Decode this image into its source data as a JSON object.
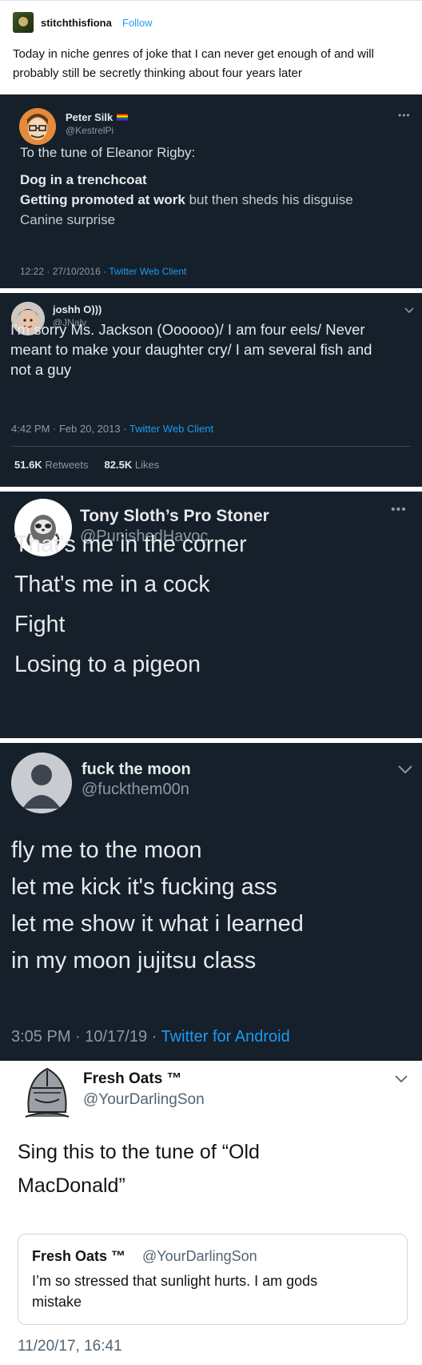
{
  "post": {
    "username": "stitchthisfiona",
    "follow_label": "Follow",
    "text": "Today in niche genres of joke that I can never get enough of and will probably still be secretly thinking about four years later"
  },
  "tweets": [
    {
      "display_name": "Peter Silk",
      "handle": "@KestrelPi",
      "icon_right": "more-icon",
      "lines": [
        {
          "text": "To the tune of Eleanor Rigby:",
          "style": "normal"
        },
        {
          "text": "Dog in a trenchcoat",
          "style": "bold"
        },
        {
          "text": "Getting promoted at work",
          "style": "bold"
        },
        {
          "text": " but then sheds his disguise",
          "style": "normal"
        },
        {
          "text": "Canine surprise",
          "style": "normal"
        }
      ],
      "timestamp": "12:22 · 27/10/2016 · ",
      "client": "Twitter Web Client"
    },
    {
      "display_name": "joshh O)))",
      "handle": "@JNalv",
      "icon_right": "chevron-down-icon",
      "lines": [
        {
          "text": "I'm sorry Ms. Jackson (Oooooo)/ I am four eels/ Never"
        },
        {
          "text": "meant to make your daughter cry/ I am several fish and"
        },
        {
          "text": "not a guy"
        }
      ],
      "timestamp": "4:42 PM · Feb 20, 2013 · ",
      "client": "Twitter Web Client",
      "retweets_count": "51.6K",
      "retweets_label": "Retweets",
      "likes_count": "82.5K",
      "likes_label": "Likes"
    },
    {
      "display_name": "Tony Sloth’s Pro Stoner",
      "handle": "@PunishedHavoc",
      "icon_right": "more-icon",
      "lines": [
        {
          "text": "That's me in the corner"
        },
        {
          "text": "That's me in a cock"
        },
        {
          "text": "Fight"
        },
        {
          "text": "Losing to a pigeon"
        }
      ]
    },
    {
      "display_name": "fuck the moon",
      "handle": "@fuckthem00n",
      "icon_right": "chevron-down-icon",
      "lines": [
        {
          "text": "fly me to the moon"
        },
        {
          "text": "let me kick it's fucking ass"
        },
        {
          "text": "let me show it what i learned"
        },
        {
          "text": "in my moon jujitsu class"
        }
      ],
      "timestamp": "3:05 PM · 10/17/19 · ",
      "client": "Twitter for Android"
    },
    {
      "display_name": "Fresh Oats ™",
      "handle": "@YourDarlingSon",
      "icon_right": "chevron-down-icon",
      "lines": [
        {
          "text": "Sing this to the tune of “Old"
        },
        {
          "text": "MacDonald”"
        }
      ],
      "quote": {
        "display_name": "Fresh Oats ™",
        "handle": "@YourDarlingSon",
        "lines": [
          {
            "text": "I’m so stressed that sunlight hurts. I am gods"
          },
          {
            "text": "mistake"
          }
        ]
      },
      "timestamp": "11/20/17, 16:41"
    }
  ],
  "colors": {
    "dark_background": "#15202b",
    "link_blue": "#1d9bf0",
    "muted_gray": "#8b98a5"
  }
}
